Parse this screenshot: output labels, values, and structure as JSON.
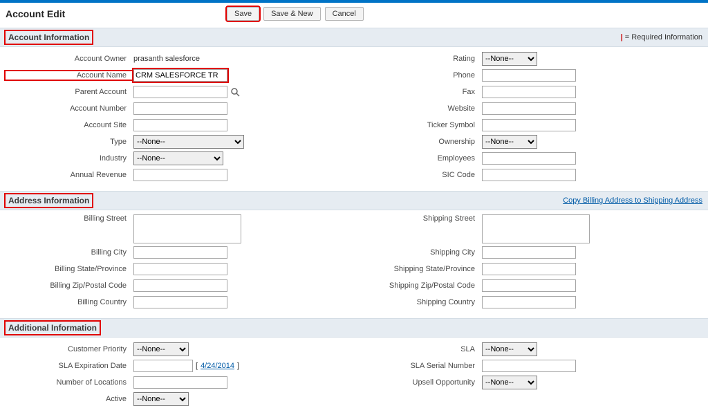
{
  "header": {
    "title": "Account Edit"
  },
  "buttons": {
    "save": "Save",
    "save_new": "Save & New",
    "cancel": "Cancel"
  },
  "required_info": "= Required Information",
  "sections": {
    "account_info": "Account Information",
    "address_info": "Address Information",
    "additional_info": "Additional Information"
  },
  "copy_link": "Copy Billing Address to Shipping Address",
  "none_option": "--None--",
  "date_hint": "4/24/2014",
  "left": {
    "account_owner_lbl": "Account Owner",
    "account_owner_val": "prasanth salesforce",
    "account_name_lbl": "Account Name",
    "account_name_val": "CRM SALESFORCE TR",
    "parent_account_lbl": "Parent Account",
    "account_number_lbl": "Account Number",
    "account_site_lbl": "Account Site",
    "type_lbl": "Type",
    "industry_lbl": "Industry",
    "annual_revenue_lbl": "Annual Revenue"
  },
  "right": {
    "rating_lbl": "Rating",
    "phone_lbl": "Phone",
    "fax_lbl": "Fax",
    "website_lbl": "Website",
    "ticker_lbl": "Ticker Symbol",
    "ownership_lbl": "Ownership",
    "employees_lbl": "Employees",
    "sic_lbl": "SIC Code"
  },
  "addr": {
    "bill_street": "Billing Street",
    "bill_city": "Billing City",
    "bill_state": "Billing State/Province",
    "bill_zip": "Billing Zip/Postal Code",
    "bill_country": "Billing Country",
    "ship_street": "Shipping Street",
    "ship_city": "Shipping City",
    "ship_state": "Shipping State/Province",
    "ship_zip": "Shipping Zip/Postal Code",
    "ship_country": "Shipping Country"
  },
  "add": {
    "cust_priority": "Customer Priority",
    "sla_exp": "SLA Expiration Date",
    "num_loc": "Number of Locations",
    "active": "Active",
    "sla": "SLA",
    "sla_serial": "SLA Serial Number",
    "upsell": "Upsell Opportunity"
  }
}
